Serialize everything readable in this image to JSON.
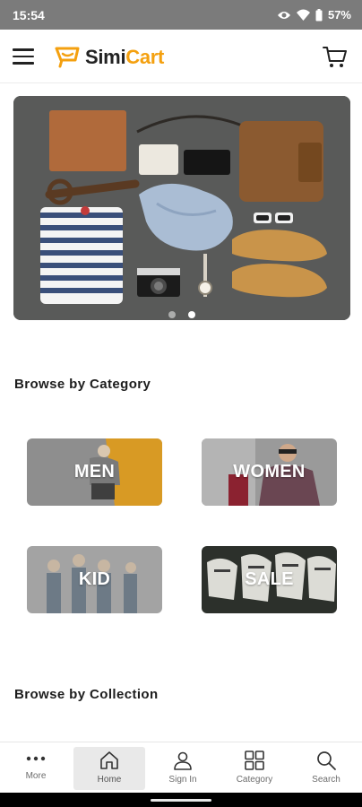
{
  "status_bar": {
    "time": "15:54",
    "battery": "57%"
  },
  "header": {
    "logo_simi": "Simi",
    "logo_cart": "Cart"
  },
  "banner": {
    "slide_count": 2,
    "active_slide": 2
  },
  "sections": {
    "category_title": "Browse by Category",
    "collection_title": "Browse by Collection"
  },
  "categories": [
    {
      "label": "MEN"
    },
    {
      "label": "WOMEN"
    },
    {
      "label": "KID"
    },
    {
      "label": "SALE"
    }
  ],
  "bottom_nav": {
    "items": [
      {
        "label": "More",
        "icon": "more-dots-icon"
      },
      {
        "label": "Home",
        "icon": "home-icon",
        "active": true
      },
      {
        "label": "Sign In",
        "icon": "user-icon"
      },
      {
        "label": "Category",
        "icon": "grid-icon"
      },
      {
        "label": "Search",
        "icon": "search-icon"
      }
    ]
  },
  "colors": {
    "brand": "#f4a00f",
    "status_bar": "#7b7b7b"
  }
}
